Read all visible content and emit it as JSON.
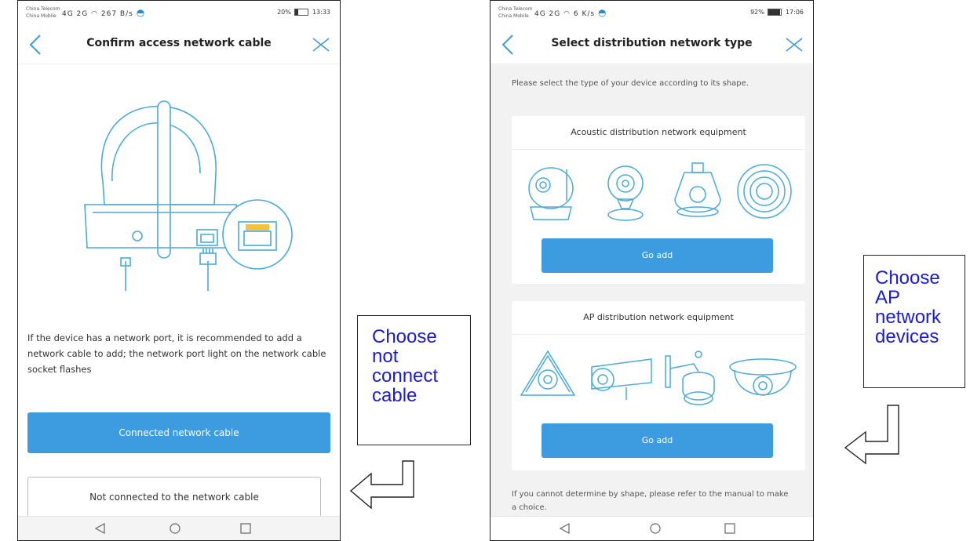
{
  "left_screen": {
    "status": {
      "carrier1": "China Telecom",
      "carrier2": "China Mobile",
      "signal": "4G 2G",
      "speed": "267 B/s",
      "battery": "20%",
      "battery_level": 0.2,
      "time": "13:33"
    },
    "title": "Confirm access network cable",
    "description": "If the device has a network port, it is recommended to add a network cable to add; the network port light on the network cable socket flashes",
    "primary_button": "Connected network cable",
    "secondary_button": "Not connected to the network cable"
  },
  "right_screen": {
    "status": {
      "carrier1": "China Telecom",
      "carrier2": "China Mobile",
      "signal": "4G 2G",
      "speed": "6 K/s",
      "battery": "92%",
      "battery_level": 0.92,
      "time": "17:06"
    },
    "title": "Select distribution network type",
    "intro": "Please select the type of your device according to its shape.",
    "acoustic": {
      "title": "Acoustic distribution network equipment",
      "button": "Go add",
      "icons": [
        "ptz-camera-icon",
        "mini-camera-icon",
        "bulb-camera-icon",
        "round-speaker-camera-icon"
      ]
    },
    "ap": {
      "title": "AP distribution network equipment",
      "button": "Go add",
      "icons": [
        "fisheye-camera-icon",
        "bullet-camera-icon",
        "wall-dome-camera-icon",
        "dome-camera-icon"
      ]
    },
    "footer_note": "If you cannot determine by shape, please refer to the manual to make a choice."
  },
  "callouts": {
    "left": "Choose not connect cable",
    "right": "Choose AP network devices"
  },
  "colors": {
    "accent": "#3d9be0",
    "icon_stroke": "#4aaad8",
    "port_highlight": "#f5c23d",
    "callout_text": "#1a1ad9"
  }
}
